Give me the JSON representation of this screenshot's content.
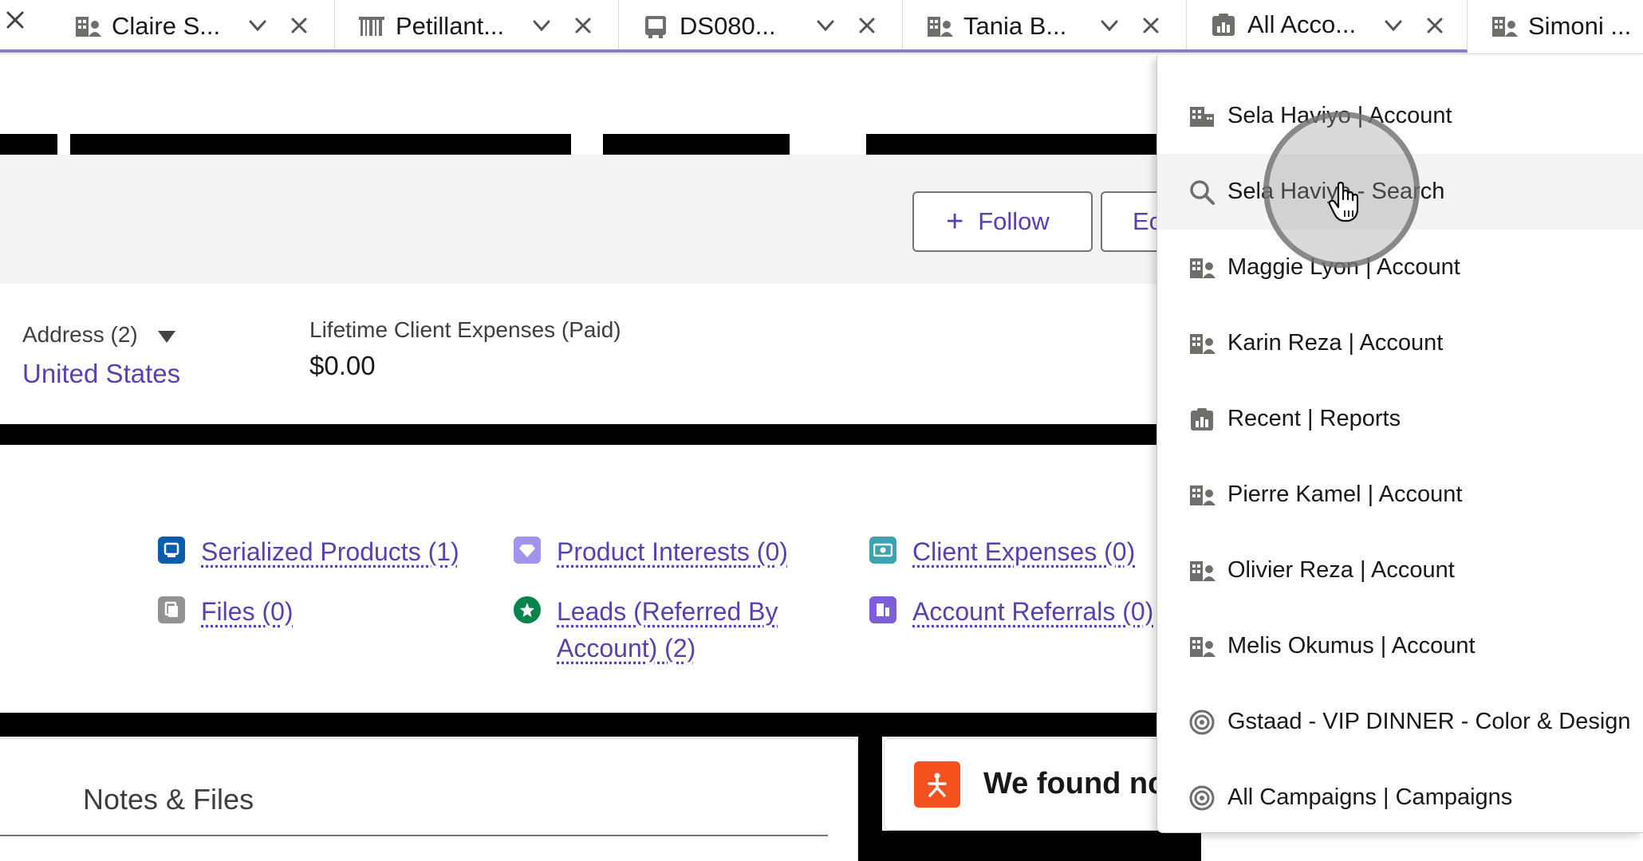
{
  "tabs": [
    {
      "label": "Claire S...",
      "icon": "account-icon"
    },
    {
      "label": "Petillant...",
      "icon": "barcode-icon"
    },
    {
      "label": "DS080...",
      "icon": "device-icon"
    },
    {
      "label": "Tania B...",
      "icon": "account-icon"
    },
    {
      "label": "All Acco...",
      "icon": "report-icon"
    },
    {
      "label": "Simoni ...",
      "icon": "account-icon"
    }
  ],
  "actions": {
    "follow_label": "Follow",
    "edit_label": "Ec"
  },
  "fields": {
    "address_label": "Address (2)",
    "address_value": "United States",
    "expense_label": "Lifetime Client Expenses (Paid)",
    "expense_value": "$0.00"
  },
  "related_links": [
    {
      "label": "Serialized Products (1)",
      "color": "#0b5cab"
    },
    {
      "label": "Product Interests (0)",
      "color": "#a094ed"
    },
    {
      "label": "Client Expenses (0)",
      "color": "#3ba3b1"
    },
    {
      "label": "Files (0)",
      "color": "#939393"
    },
    {
      "label": "Leads (Referred By Account) (2)",
      "color": "#04844b"
    },
    {
      "label": "Account Referrals (0)",
      "color": "#7f5fd9"
    }
  ],
  "cards": {
    "notes_title": "Notes & Files",
    "found_text": "We found nc"
  },
  "dropdown": {
    "items": [
      {
        "label": "Sela Haviyo | Account",
        "icon": "building-icon"
      },
      {
        "label": "Sela Haviyo - Search",
        "icon": "search-icon"
      },
      {
        "label": "Maggie Lyon | Account",
        "icon": "account-icon"
      },
      {
        "label": "Karin Reza | Account",
        "icon": "account-icon"
      },
      {
        "label": "Recent | Reports",
        "icon": "report-icon"
      },
      {
        "label": "Pierre Kamel | Account",
        "icon": "account-icon"
      },
      {
        "label": "Olivier Reza | Account",
        "icon": "account-icon"
      },
      {
        "label": "Melis Okumus | Account",
        "icon": "account-icon"
      },
      {
        "label": "Gstaad - VIP DINNER - Color & Design",
        "icon": "campaign-icon"
      },
      {
        "label": "All Campaigns | Campaigns",
        "icon": "campaign-icon"
      }
    ]
  },
  "colors": {
    "brand": "#5b3fb0",
    "tab_accent": "#8f7cc7",
    "found_icon": "#f4511e"
  }
}
